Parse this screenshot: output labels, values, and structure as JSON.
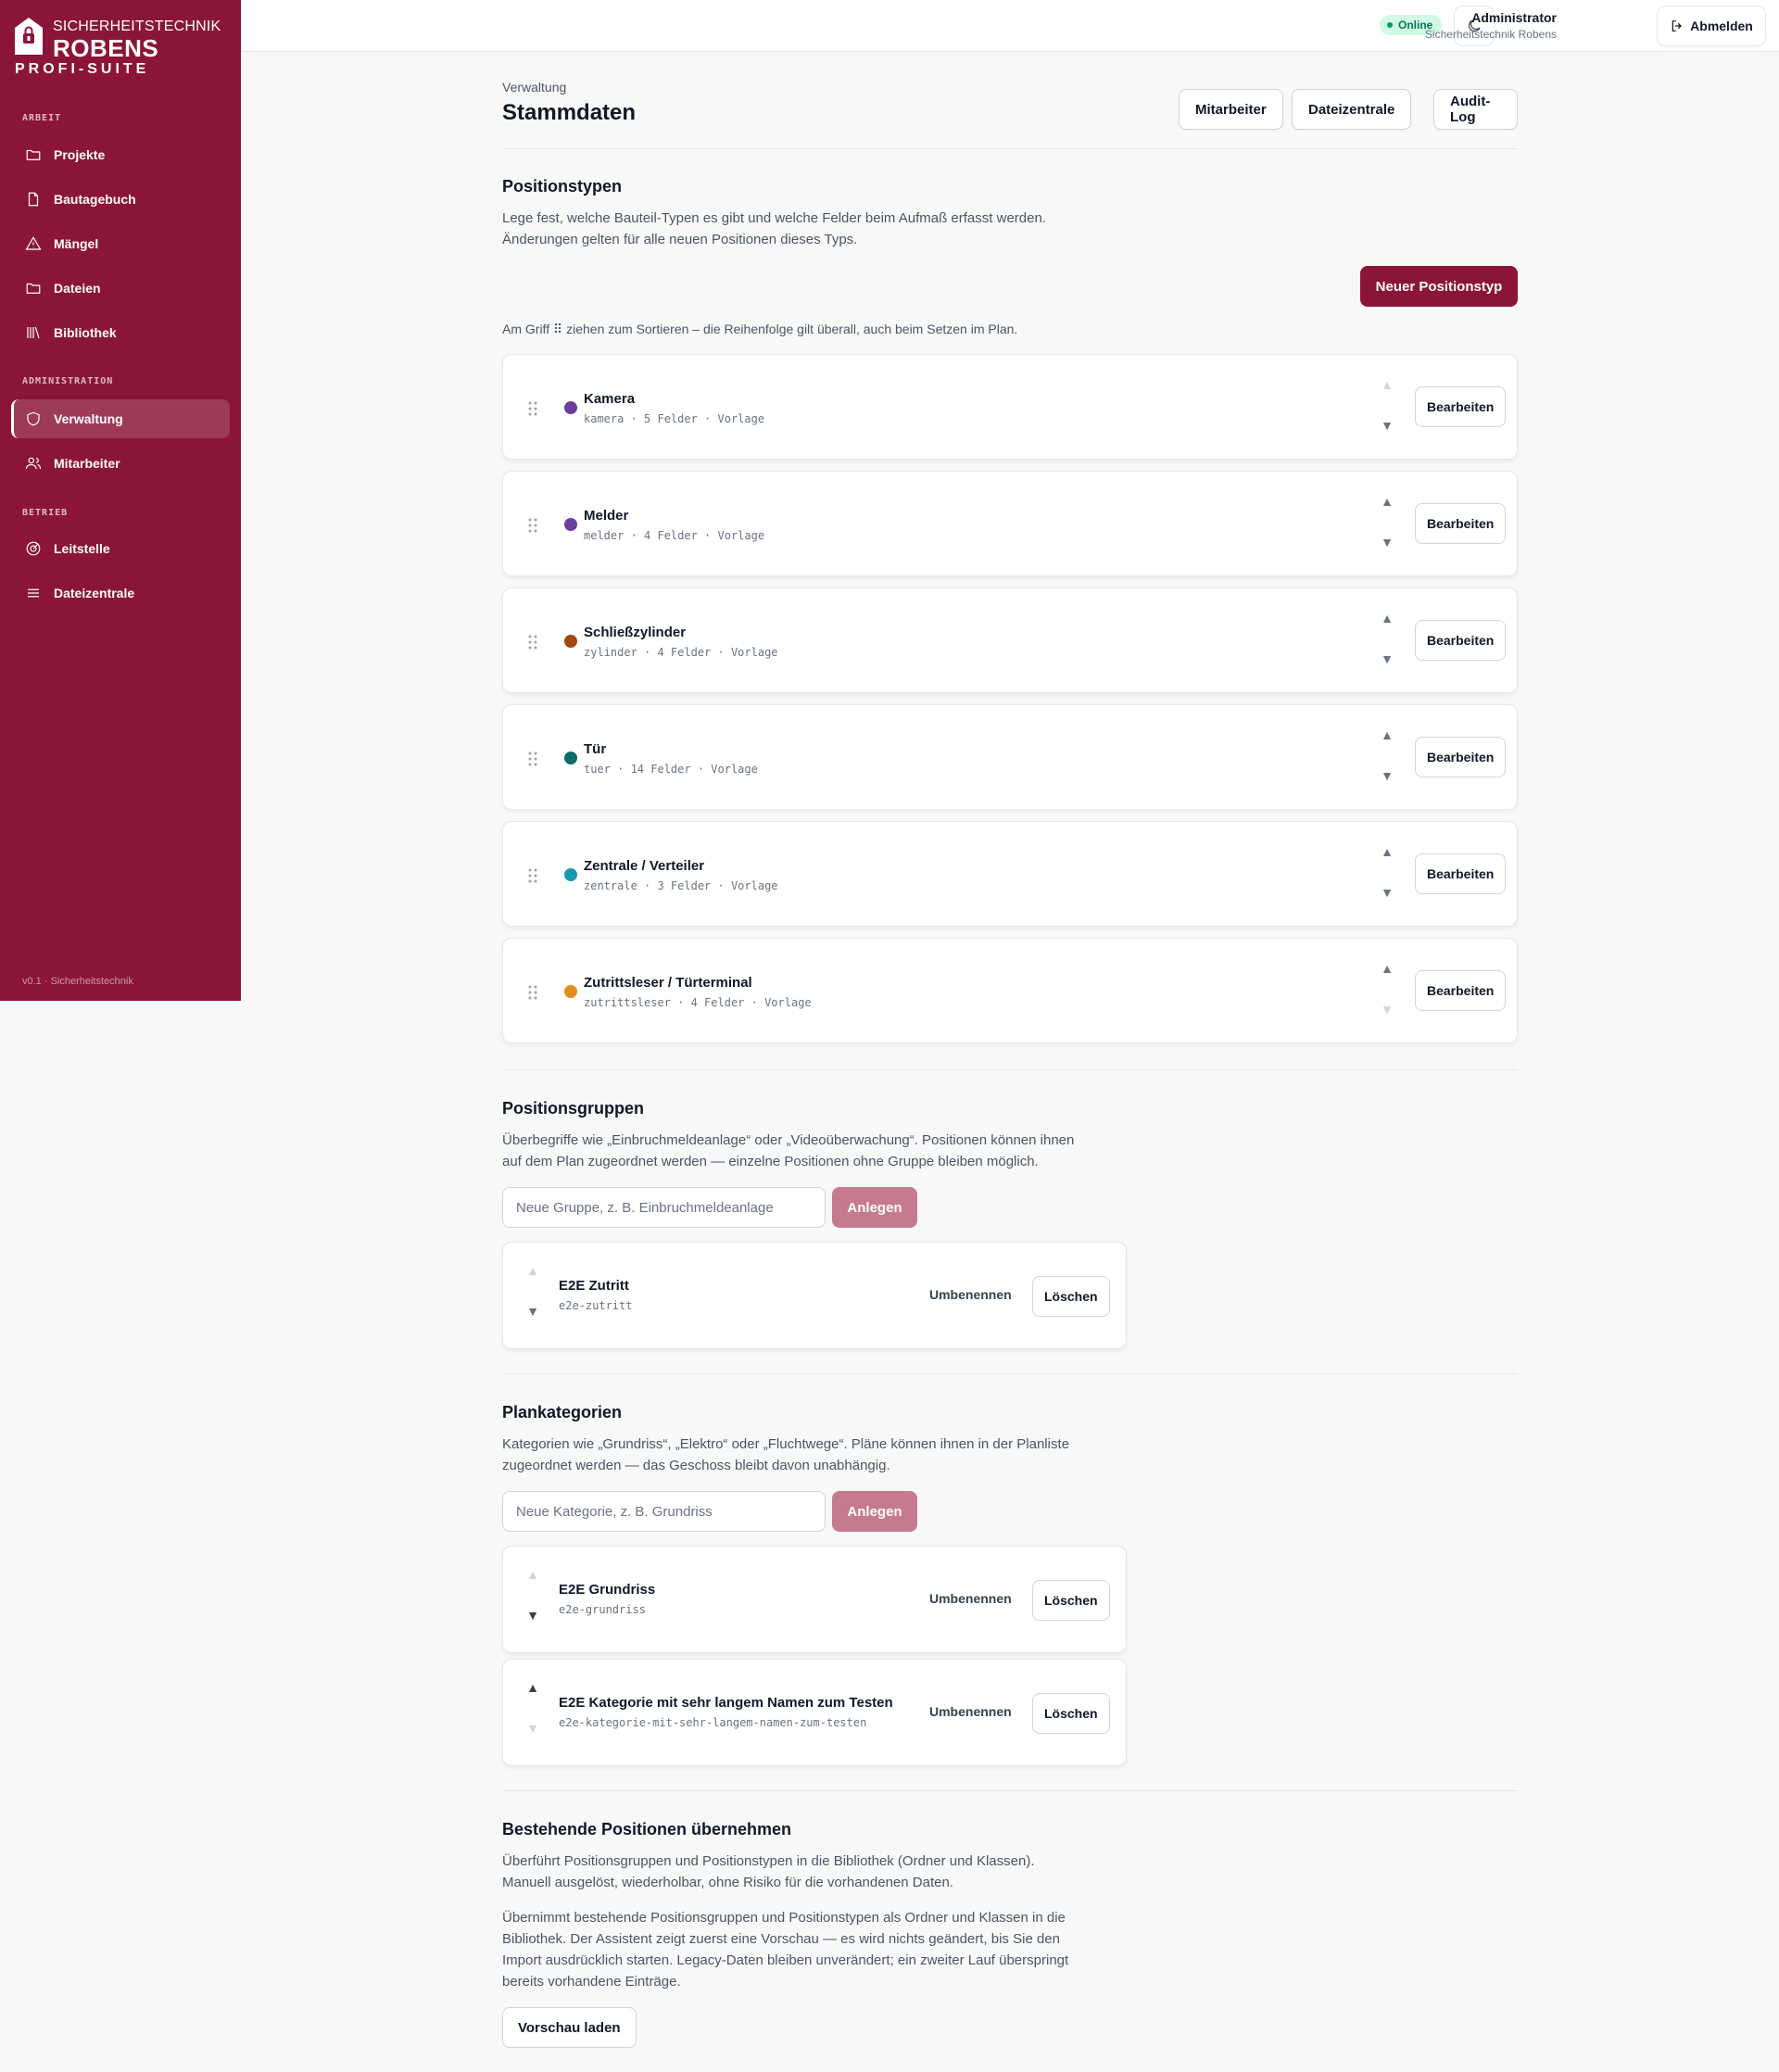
{
  "brand": {
    "line1": "SICHERHEITSTECHNIK",
    "line2": "ROBENS",
    "line3": "PROFI-SUITE"
  },
  "sidebar": {
    "sections": [
      {
        "title": "ARBEIT",
        "items": [
          {
            "label": "Projekte",
            "icon": "folder-icon"
          },
          {
            "label": "Bautagebuch",
            "icon": "file-icon"
          },
          {
            "label": "Mängel",
            "icon": "warning-icon"
          },
          {
            "label": "Dateien",
            "icon": "folder-icon"
          },
          {
            "label": "Bibliothek",
            "icon": "library-icon"
          }
        ]
      },
      {
        "title": "ADMINISTRATION",
        "items": [
          {
            "label": "Verwaltung",
            "icon": "shield-icon",
            "active": true
          },
          {
            "label": "Mitarbeiter",
            "icon": "users-icon"
          }
        ]
      },
      {
        "title": "BETRIEB",
        "items": [
          {
            "label": "Leitstelle",
            "icon": "radar-icon"
          },
          {
            "label": "Dateizentrale",
            "icon": "menu-icon"
          }
        ]
      }
    ],
    "version": "v0.1 · Sicherheitstechnik"
  },
  "topbar": {
    "status": "Online",
    "user_name": "Administrator",
    "user_org": "Sicherheitstechnik Robens",
    "logout_label": "Abmelden"
  },
  "header": {
    "breadcrumb": "Verwaltung",
    "title": "Stammdaten",
    "buttons": [
      "Mitarbeiter",
      "Dateizentrale",
      "Audit-Log"
    ]
  },
  "positionstypen": {
    "title": "Positionstypen",
    "desc1": "Lege fest, welche Bauteil-Typen es gibt und welche Felder beim Aufmaß erfasst werden.",
    "desc2": "Änderungen gelten für alle neuen Positionen dieses Typs.",
    "new_button": "Neuer Positionstyp",
    "hint": "Am Griff ⠿ ziehen zum Sortieren – die Reihenfolge gilt überall, auch beim Setzen im Plan.",
    "edit_label": "Bearbeiten",
    "items": [
      {
        "name": "Kamera",
        "meta": "kamera · 5 Felder · Vorlage",
        "color": "#6b3fa0"
      },
      {
        "name": "Melder",
        "meta": "melder · 4 Felder · Vorlage",
        "color": "#6b3fa0"
      },
      {
        "name": "Schließzylinder",
        "meta": "zylinder · 4 Felder · Vorlage",
        "color": "#a0480f"
      },
      {
        "name": "Tür",
        "meta": "tuer · 14 Felder · Vorlage",
        "color": "#0f6b63"
      },
      {
        "name": "Zentrale / Verteiler",
        "meta": "zentrale · 3 Felder · Vorlage",
        "color": "#1797b0"
      },
      {
        "name": "Zutrittsleser / Türterminal",
        "meta": "zutrittsleser · 4 Felder · Vorlage",
        "color": "#e0901a"
      }
    ]
  },
  "positionsgruppen": {
    "title": "Positionsgruppen",
    "desc1": "Überbegriffe wie „Einbruchmeldeanlage“ oder „Videoüberwachung“. Positionen können ihnen",
    "desc2": "auf dem Plan zugeordnet werden — einzelne Positionen ohne Gruppe bleiben möglich.",
    "placeholder": "Neue Gruppe, z. B. Einbruchmeldeanlage",
    "create_label": "Anlegen",
    "rename_label": "Umbenennen",
    "delete_label": "Löschen",
    "items": [
      {
        "name": "E2E Zutritt",
        "slug": "e2e-zutritt"
      }
    ]
  },
  "plankategorien": {
    "title": "Plankategorien",
    "desc1": "Kategorien wie „Grundriss“, „Elektro“ oder „Fluchtwege“. Pläne können ihnen in der Planliste",
    "desc2": "zugeordnet werden — das Geschoss bleibt davon unabhängig.",
    "placeholder": "Neue Kategorie, z. B. Grundriss",
    "create_label": "Anlegen",
    "rename_label": "Umbenennen",
    "delete_label": "Löschen",
    "items": [
      {
        "name": "E2E Grundriss",
        "slug": "e2e-grundriss"
      },
      {
        "name": "E2E Kategorie mit sehr langem Namen zum Testen",
        "slug": "e2e-kategorie-mit-sehr-langem-namen-zum-testen"
      }
    ]
  },
  "import": {
    "title": "Bestehende Positionen übernehmen",
    "desc1": "Überführt Positionsgruppen und Positionstypen in die Bibliothek (Ordner und Klassen).",
    "desc2": "Manuell ausgelöst, wiederholbar, ohne Risiko für die vorhandenen Daten.",
    "body1": "Übernimmt bestehende Positionsgruppen und Positionstypen als Ordner und Klassen in die",
    "body2": "Bibliothek. Der Assistent zeigt zuerst eine Vorschau — es wird nichts geändert, bis Sie den",
    "body3": "Import ausdrücklich starten. Legacy-Daten bleiben unverändert; ein zweiter Lauf überspringt",
    "body4": "bereits vorhandene Einträge.",
    "button": "Vorschau laden"
  }
}
